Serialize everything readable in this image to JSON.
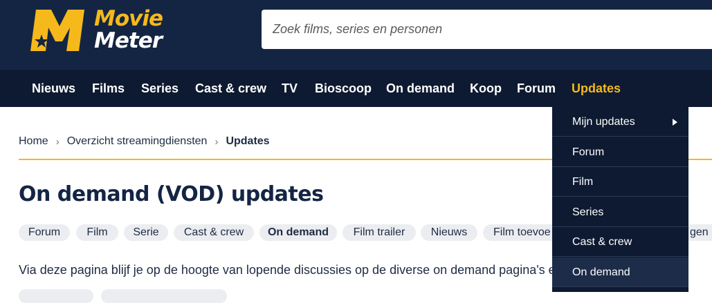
{
  "logo": {
    "line1": "Movie",
    "line2": "Meter",
    "mark": "M"
  },
  "search": {
    "placeholder": "Zoek films, series en personen"
  },
  "nav": {
    "items": [
      "Nieuws",
      "Films",
      "Series",
      "Cast & crew",
      "TV",
      "Bioscoop",
      "On demand",
      "Koop",
      "Forum",
      "Updates"
    ],
    "active": "Updates"
  },
  "breadcrumb": {
    "home": "Home",
    "parent": "Overzicht streamingdiensten",
    "current": "Updates",
    "separator": "›"
  },
  "page": {
    "title": "On demand (VOD) updates",
    "intro": "Via deze pagina blijf je op de hoogte van lopende discussies op de diverse on demand pagina's e"
  },
  "filters": {
    "items": [
      "Forum",
      "Film",
      "Serie",
      "Cast & crew",
      "On demand",
      "Film trailer",
      "Nieuws",
      "Film toevoe"
    ],
    "active": "On demand",
    "overflow_fragment": "gen"
  },
  "dropdown": {
    "items": [
      "Mijn updates",
      "Forum",
      "Film",
      "Series",
      "Cast & crew",
      "On demand"
    ],
    "active": "On demand"
  },
  "colors": {
    "brand_navy": "#142544",
    "nav_bg": "#0d1a31",
    "accent_yellow": "#f5b91c"
  }
}
